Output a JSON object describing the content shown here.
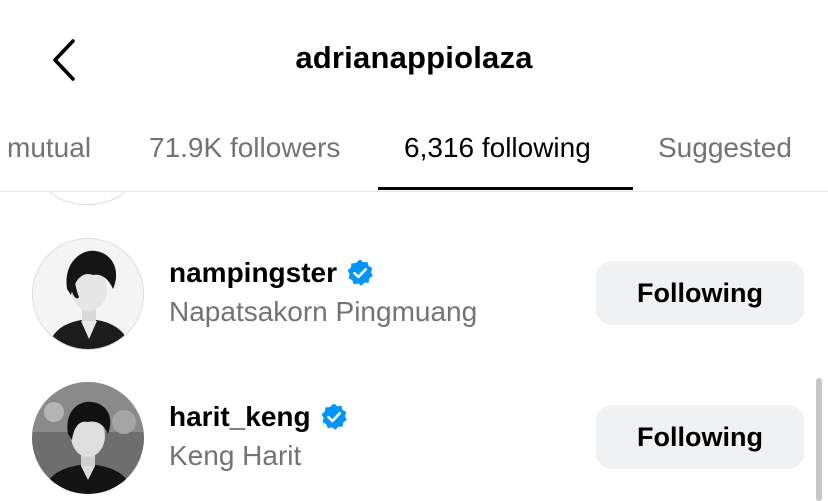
{
  "header": {
    "title": "adrianappiolaza",
    "back_icon": "chevron-left-icon"
  },
  "tabs": [
    {
      "label": "mutual",
      "active": false
    },
    {
      "label": "71.9K followers",
      "active": false
    },
    {
      "label": "6,316 following",
      "active": true
    },
    {
      "label": "Suggested",
      "active": false
    }
  ],
  "list": [
    {
      "username": "nampingster",
      "full_name": "Napatsakorn Pingmuang",
      "verified": true,
      "button_label": "Following"
    },
    {
      "username": "harit_keng",
      "full_name": "Keng Harit",
      "verified": true,
      "button_label": "Following"
    }
  ],
  "colors": {
    "verified_blue": "#0095f6",
    "secondary_text": "#737373",
    "button_bg": "#eff1f3"
  }
}
